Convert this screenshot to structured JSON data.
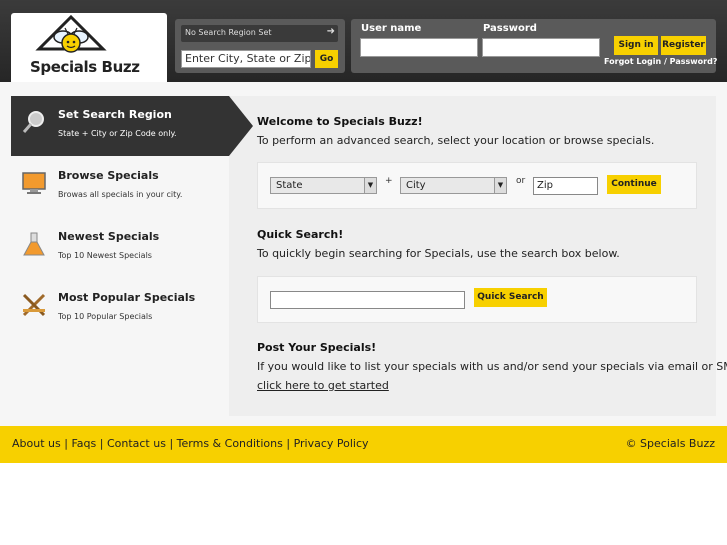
{
  "brand": {
    "name": "Specials Buzz"
  },
  "header": {
    "region_status": "No Search Region Set",
    "city_placeholder": "Enter City, State or Zip",
    "go_label": "Go",
    "username_label": "User name",
    "password_label": "Password",
    "signin_label": "Sign in",
    "register_label": "Register",
    "forgot_label": "Forgot Login / Password?"
  },
  "sidebar": {
    "items": [
      {
        "title": "Set Search Region",
        "desc": "State + City or Zip Code only.",
        "icon": "magnifier-icon"
      },
      {
        "title": "Browse Specials",
        "desc": "Browas all specials in your city.",
        "icon": "monitor-icon"
      },
      {
        "title": "Newest Specials",
        "desc": "Top 10 Newest Specials",
        "icon": "flask-icon"
      },
      {
        "title": "Most Popular Specials",
        "desc": "Top 10 Popular Specials",
        "icon": "tools-icon"
      }
    ]
  },
  "main": {
    "welcome_title": "Welcome to Specials Buzz!",
    "welcome_text": "To perform an advanced search, select your location or browse specials.",
    "state_label": "State",
    "plus": "+",
    "city_label": "City",
    "or": "or",
    "zip_value": "Zip",
    "continue_label": "Continue",
    "quick_title": "Quick Search!",
    "quick_text": "To quickly begin searching for Specials, use the search box below.",
    "quick_button": "Quick Search",
    "post_title": "Post Your Specials!",
    "post_text": "If you would like to list your specials with us and/or send your specials via email or SMS,",
    "post_link": "click here to get started"
  },
  "footer": {
    "links": [
      "About us",
      "Faqs",
      "Contact us",
      "Terms & Conditions",
      "Privacy Policy"
    ],
    "separator": "|",
    "copyright": "© Specials Buzz"
  },
  "colors": {
    "accent": "#f7d000",
    "header": "#2f2f2f",
    "sidebar_active": "#333333"
  }
}
